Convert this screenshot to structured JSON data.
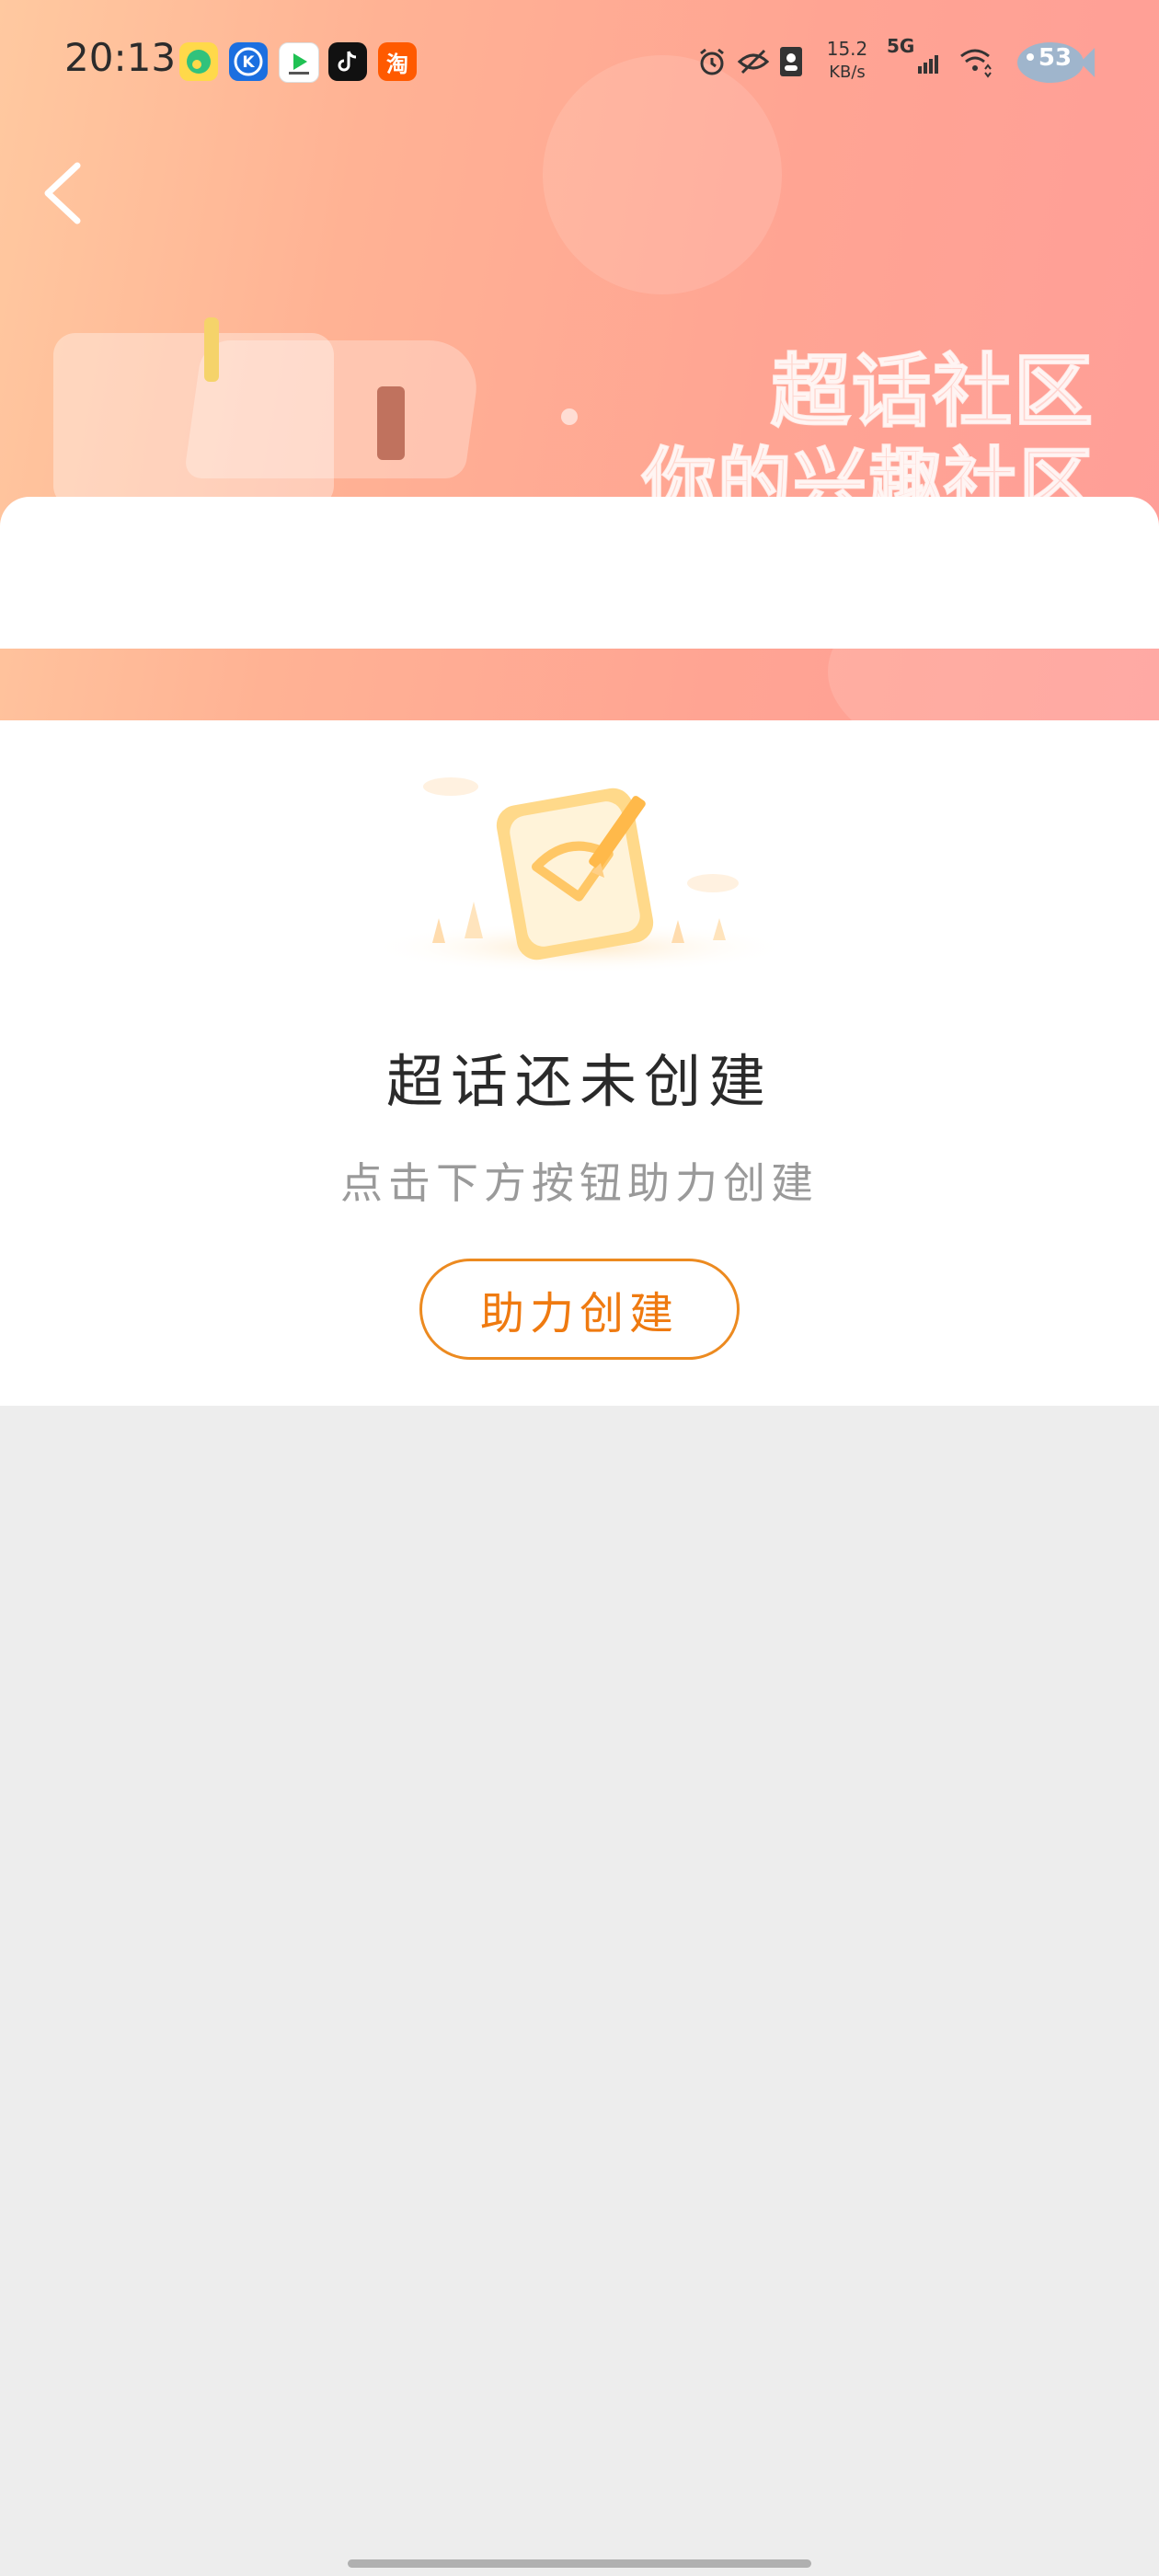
{
  "status_bar": {
    "time": "20:13",
    "net_speed_value": "15.2",
    "net_speed_unit": "KB/s",
    "network_type": "5G",
    "battery": "53",
    "app_icons": [
      "qq-music-icon",
      "kugou-icon",
      "iqiyi-icon",
      "tiktok-icon",
      "taobao-icon"
    ],
    "taobao_label": "淘"
  },
  "banner": {
    "slogan_line1": "超话社区",
    "slogan_line2": "你的兴趣社区"
  },
  "empty_state": {
    "title": "超话还未创建",
    "subtitle": "点击下方按钮助力创建",
    "button_label": "助力创建"
  },
  "colors": {
    "accent": "#ef7a10",
    "page_background": "#ededed",
    "banner_gradient": [
      "#ffc9a0",
      "#ff9e98"
    ]
  }
}
